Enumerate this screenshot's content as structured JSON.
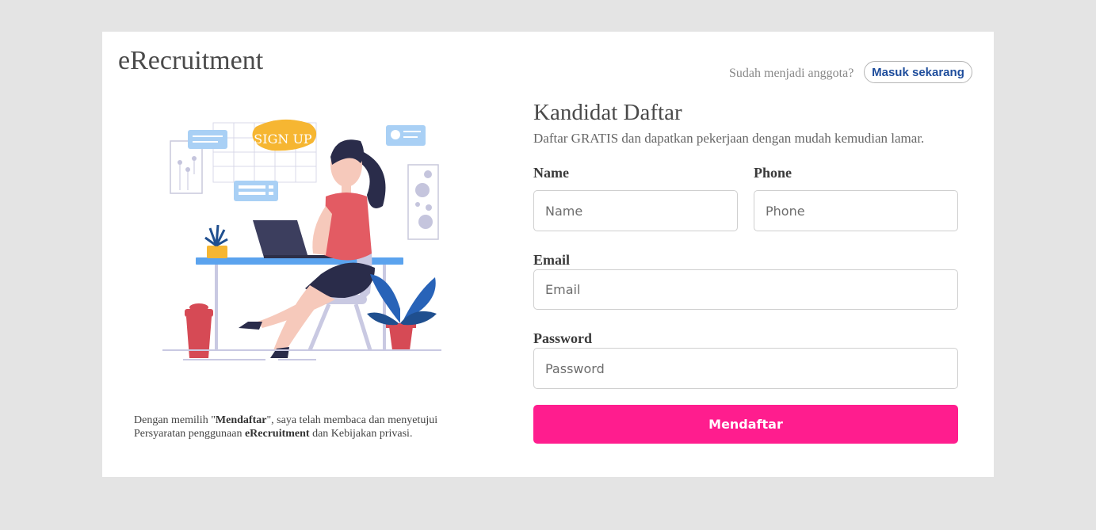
{
  "header": {
    "brand": "eRecruitment",
    "login_prompt": "Sudah menjadi anggota?",
    "login_button": "Masuk sekarang"
  },
  "illustration": {
    "sign_text": "SIGN UP"
  },
  "terms": {
    "part1": "Dengan memilih \"",
    "bold1": "Mendaftar",
    "part2": "\", saya telah membaca dan menyetujui Persyaratan penggunaan ",
    "bold2": "eRecruitment",
    "part3": " dan Kebijakan privasi."
  },
  "form": {
    "title": "Kandidat Daftar",
    "subtitle": "Daftar GRATIS dan dapatkan pekerjaan dengan mudah kemudian lamar.",
    "name_label": "Name",
    "name_placeholder": "Name",
    "phone_label": "Phone",
    "phone_placeholder": "Phone",
    "email_label": "Email",
    "email_placeholder": "Email",
    "password_label": "Password",
    "password_placeholder": "Password",
    "submit_label": "Mendaftar"
  },
  "colors": {
    "accent": "#ff1d8e",
    "link": "#1e4d9c",
    "background": "#e4e4e4"
  }
}
